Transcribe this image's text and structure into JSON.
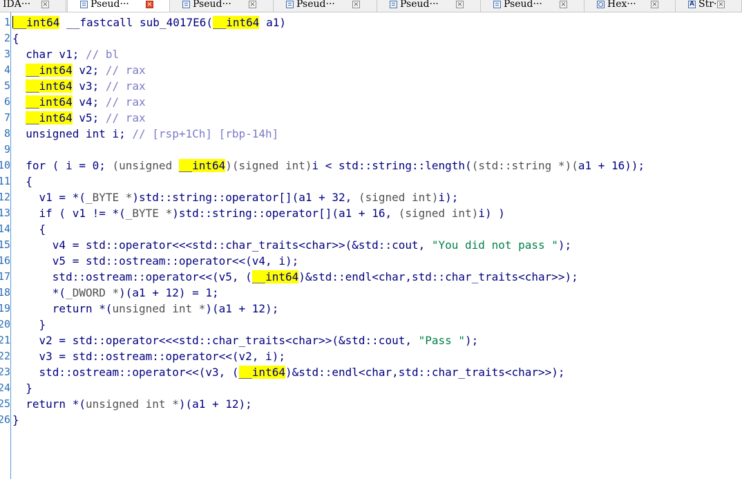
{
  "tabs": [
    {
      "label": "IDA···",
      "icon": "none",
      "active": false
    },
    {
      "label": "Pseud···",
      "icon": "pseudocode-icon",
      "active": true
    },
    {
      "label": "Pseud···",
      "icon": "pseudocode-icon",
      "active": false
    },
    {
      "label": "Pseud···",
      "icon": "pseudocode-icon",
      "active": false
    },
    {
      "label": "Pseud···",
      "icon": "pseudocode-icon",
      "active": false
    },
    {
      "label": "Pseud···",
      "icon": "pseudocode-icon",
      "active": false
    },
    {
      "label": "Hex···",
      "icon": "hex-view-icon",
      "active": false
    },
    {
      "label": "Str···",
      "icon": "strings-icon",
      "active": false
    }
  ],
  "strings_icon_glyph": "A",
  "close_glyph": "×",
  "colors": {
    "keyword": "#000080",
    "comment": "#7a7ac8",
    "string": "#00804a",
    "highlight": "#ffff00",
    "line_number": "#2a6fb5",
    "active_tab_close": "#e04a2a"
  },
  "code_lines": [
    {
      "n": "1",
      "tokens": [
        [
          "hl",
          "__int64"
        ],
        [
          "k",
          " __fastcall sub_4017E6("
        ],
        [
          "hl",
          "__int64"
        ],
        [
          "k",
          " a1)"
        ]
      ]
    },
    {
      "n": "2",
      "tokens": [
        [
          "k",
          "{"
        ]
      ]
    },
    {
      "n": "3",
      "tokens": [
        [
          "k",
          "  char v1; "
        ],
        [
          "c",
          "// bl"
        ]
      ]
    },
    {
      "n": "4",
      "tokens": [
        [
          "k",
          "  "
        ],
        [
          "hl",
          "__int64"
        ],
        [
          "k",
          " v2; "
        ],
        [
          "c",
          "// rax"
        ]
      ]
    },
    {
      "n": "5",
      "tokens": [
        [
          "k",
          "  "
        ],
        [
          "hl",
          "__int64"
        ],
        [
          "k",
          " v3; "
        ],
        [
          "c",
          "// rax"
        ]
      ]
    },
    {
      "n": "6",
      "tokens": [
        [
          "k",
          "  "
        ],
        [
          "hl",
          "__int64"
        ],
        [
          "k",
          " v4; "
        ],
        [
          "c",
          "// rax"
        ]
      ]
    },
    {
      "n": "7",
      "tokens": [
        [
          "k",
          "  "
        ],
        [
          "hl",
          "__int64"
        ],
        [
          "k",
          " v5; "
        ],
        [
          "c",
          "// rax"
        ]
      ]
    },
    {
      "n": "8",
      "tokens": [
        [
          "k",
          "  unsigned int i; "
        ],
        [
          "c",
          "// [rsp+1Ch] [rbp-14h]"
        ]
      ]
    },
    {
      "n": "9",
      "tokens": [
        [
          "k",
          ""
        ]
      ]
    },
    {
      "n": "10",
      "tokens": [
        [
          "k",
          "  for ( "
        ],
        [
          "v",
          "i"
        ],
        [
          "k",
          " = 0; "
        ],
        [
          "g",
          "(unsigned "
        ],
        [
          "hl",
          "__int64"
        ],
        [
          "g",
          ")(signed int)"
        ],
        [
          "v",
          "i"
        ],
        [
          "k",
          " < std::string::length("
        ],
        [
          "g",
          "(std::string *)("
        ],
        [
          "v",
          "a1"
        ],
        [
          "k",
          " + 16));"
        ]
      ]
    },
    {
      "n": "11",
      "tokens": [
        [
          "k",
          "  {"
        ]
      ]
    },
    {
      "n": "12",
      "tokens": [
        [
          "k",
          "    "
        ],
        [
          "v",
          "v1"
        ],
        [
          "k",
          " = *("
        ],
        [
          "g",
          "_BYTE *"
        ],
        [
          "k",
          ")std::string::operator[]("
        ],
        [
          "v",
          "a1"
        ],
        [
          "k",
          " + 32, "
        ],
        [
          "g",
          "(signed int)"
        ],
        [
          "v",
          "i"
        ],
        [
          "k",
          ");"
        ]
      ]
    },
    {
      "n": "13",
      "tokens": [
        [
          "k",
          "    if ( "
        ],
        [
          "v",
          "v1"
        ],
        [
          "k",
          " != *("
        ],
        [
          "g",
          "_BYTE *"
        ],
        [
          "k",
          ")std::string::operator[]("
        ],
        [
          "v",
          "a1"
        ],
        [
          "k",
          " + 16, "
        ],
        [
          "g",
          "(signed int)"
        ],
        [
          "v",
          "i"
        ],
        [
          "k",
          ") )"
        ]
      ]
    },
    {
      "n": "14",
      "tokens": [
        [
          "k",
          "    {"
        ]
      ]
    },
    {
      "n": "15",
      "tokens": [
        [
          "k",
          "      "
        ],
        [
          "v",
          "v4"
        ],
        [
          "k",
          " = std::operator<<<std::char_traits<char>>(&std::cout, "
        ],
        [
          "s",
          "\"You did not pass \""
        ],
        [
          "k",
          ");"
        ]
      ]
    },
    {
      "n": "16",
      "tokens": [
        [
          "k",
          "      "
        ],
        [
          "v",
          "v5"
        ],
        [
          "k",
          " = std::ostream::operator<<("
        ],
        [
          "v",
          "v4"
        ],
        [
          "k",
          ", "
        ],
        [
          "v",
          "i"
        ],
        [
          "k",
          ");"
        ]
      ]
    },
    {
      "n": "17",
      "tokens": [
        [
          "k",
          "      std::ostream::operator<<("
        ],
        [
          "v",
          "v5"
        ],
        [
          "k",
          ", ("
        ],
        [
          "hl",
          "__int64"
        ],
        [
          "k",
          ")&std::endl<char,std::char_traits<char>>);"
        ]
      ]
    },
    {
      "n": "18",
      "tokens": [
        [
          "k",
          "      *("
        ],
        [
          "g",
          "_DWORD *"
        ],
        [
          "k",
          ")("
        ],
        [
          "v",
          "a1"
        ],
        [
          "k",
          " + 12) = 1;"
        ]
      ]
    },
    {
      "n": "19",
      "tokens": [
        [
          "k",
          "      return *("
        ],
        [
          "g",
          "unsigned int *"
        ],
        [
          "k",
          ")("
        ],
        [
          "v",
          "a1"
        ],
        [
          "k",
          " + 12);"
        ]
      ]
    },
    {
      "n": "20",
      "tokens": [
        [
          "k",
          "    }"
        ]
      ]
    },
    {
      "n": "21",
      "tokens": [
        [
          "k",
          "    "
        ],
        [
          "v",
          "v2"
        ],
        [
          "k",
          " = std::operator<<<std::char_traits<char>>(&std::cout, "
        ],
        [
          "s",
          "\"Pass \""
        ],
        [
          "k",
          ");"
        ]
      ]
    },
    {
      "n": "22",
      "tokens": [
        [
          "k",
          "    "
        ],
        [
          "v",
          "v3"
        ],
        [
          "k",
          " = std::ostream::operator<<("
        ],
        [
          "v",
          "v2"
        ],
        [
          "k",
          ", "
        ],
        [
          "v",
          "i"
        ],
        [
          "k",
          ");"
        ]
      ]
    },
    {
      "n": "23",
      "tokens": [
        [
          "k",
          "    std::ostream::operator<<("
        ],
        [
          "v",
          "v3"
        ],
        [
          "k",
          ", ("
        ],
        [
          "hl",
          "__int64"
        ],
        [
          "k",
          ")&std::endl<char,std::char_traits<char>>);"
        ]
      ]
    },
    {
      "n": "24",
      "tokens": [
        [
          "k",
          "  }"
        ]
      ]
    },
    {
      "n": "25",
      "tokens": [
        [
          "k",
          "  return *("
        ],
        [
          "g",
          "unsigned int *"
        ],
        [
          "k",
          ")("
        ],
        [
          "v",
          "a1"
        ],
        [
          "k",
          " + 12);"
        ]
      ]
    },
    {
      "n": "26",
      "tokens": [
        [
          "k",
          "}"
        ]
      ]
    }
  ]
}
